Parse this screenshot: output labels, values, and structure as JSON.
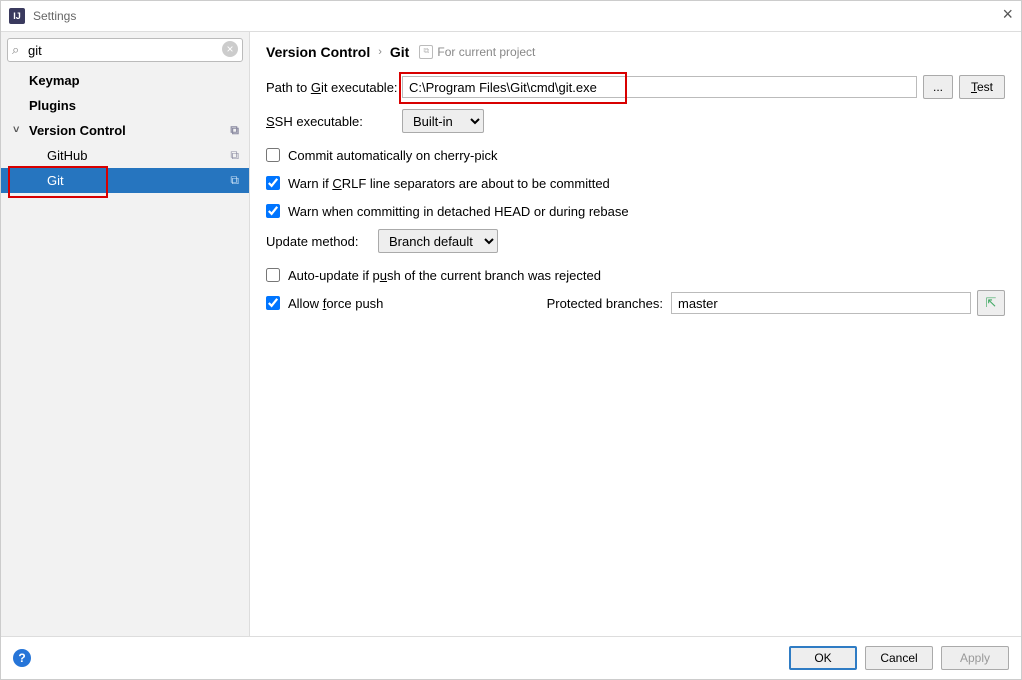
{
  "window": {
    "title": "Settings"
  },
  "sidebar": {
    "search_value": "git",
    "items": {
      "keymap": "Keymap",
      "plugins": "Plugins",
      "version_control": "Version Control",
      "github": "GitHub",
      "git": "Git"
    }
  },
  "breadcrumb": {
    "parent": "Version Control",
    "current": "Git",
    "for_project": "For current project"
  },
  "form": {
    "path_label": "Path to Git executable:",
    "path_value": "C:\\Program Files\\Git\\cmd\\git.exe",
    "browse": "...",
    "test": "Test",
    "ssh_label": "SSH executable:",
    "ssh_value": "Built-in",
    "cb_cherry": "Commit automatically on cherry-pick",
    "cb_crlf": "Warn if CRLF line separators are about to be committed",
    "cb_detached": "Warn when committing in detached HEAD or during rebase",
    "update_label": "Update method:",
    "update_value": "Branch default",
    "cb_autoupdate": "Auto-update if push of the current branch was rejected",
    "cb_forcepush": "Allow force push",
    "protected_label": "Protected branches:",
    "protected_value": "master"
  },
  "checked": {
    "cherry": false,
    "crlf": true,
    "detached": true,
    "autoupdate": false,
    "forcepush": true
  },
  "footer": {
    "ok": "OK",
    "cancel": "Cancel",
    "apply": "Apply"
  }
}
